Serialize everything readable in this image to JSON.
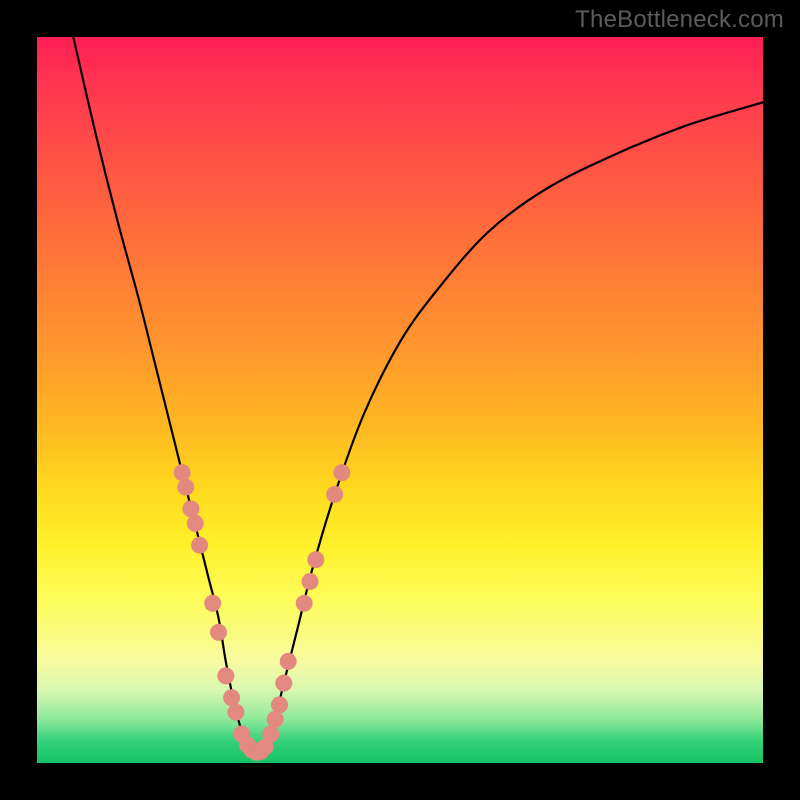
{
  "watermark": "TheBottleneck.com",
  "colors": {
    "background": "#000000",
    "gradient_top": "#ff1e55",
    "gradient_mid1": "#ff9a2c",
    "gradient_mid2": "#fff02a",
    "gradient_bottom": "#16c465",
    "curve": "#000000",
    "dots": "#e4897f"
  },
  "chart_data": {
    "type": "line",
    "title": "",
    "xlabel": "",
    "ylabel": "",
    "xlim": [
      0,
      100
    ],
    "ylim": [
      0,
      100
    ],
    "legend": false,
    "grid": false,
    "series": [
      {
        "name": "curve",
        "x": [
          5,
          8,
          11,
          14,
          16,
          18,
          20,
          22,
          23.5,
          25,
          26,
          27,
          28,
          29,
          30,
          31,
          32,
          33,
          34,
          36,
          38,
          41,
          45,
          50,
          55,
          62,
          70,
          80,
          90,
          100
        ],
        "y": [
          100,
          87,
          75,
          64,
          56,
          48,
          40,
          32,
          26,
          20,
          14,
          9,
          5,
          2.5,
          1.5,
          2,
          4,
          7,
          11,
          19,
          27,
          37,
          48,
          58,
          65,
          73,
          79,
          84,
          88,
          91
        ]
      }
    ],
    "scatter_points": {
      "name": "highlight-dots",
      "points": [
        {
          "x": 20.0,
          "y": 40
        },
        {
          "x": 20.5,
          "y": 38
        },
        {
          "x": 21.2,
          "y": 35
        },
        {
          "x": 21.8,
          "y": 33
        },
        {
          "x": 22.4,
          "y": 30
        },
        {
          "x": 24.2,
          "y": 22
        },
        {
          "x": 25.0,
          "y": 18
        },
        {
          "x": 26.0,
          "y": 12
        },
        {
          "x": 26.8,
          "y": 9
        },
        {
          "x": 27.4,
          "y": 7
        },
        {
          "x": 28.2,
          "y": 4
        },
        {
          "x": 29.0,
          "y": 2.5
        },
        {
          "x": 29.6,
          "y": 1.8
        },
        {
          "x": 30.2,
          "y": 1.5
        },
        {
          "x": 30.8,
          "y": 1.6
        },
        {
          "x": 31.4,
          "y": 2.2
        },
        {
          "x": 32.2,
          "y": 4
        },
        {
          "x": 32.8,
          "y": 6
        },
        {
          "x": 33.4,
          "y": 8
        },
        {
          "x": 34.0,
          "y": 11
        },
        {
          "x": 34.6,
          "y": 14
        },
        {
          "x": 36.8,
          "y": 22
        },
        {
          "x": 37.6,
          "y": 25
        },
        {
          "x": 38.4,
          "y": 28
        },
        {
          "x": 41.0,
          "y": 37
        },
        {
          "x": 42.0,
          "y": 40
        }
      ]
    }
  }
}
